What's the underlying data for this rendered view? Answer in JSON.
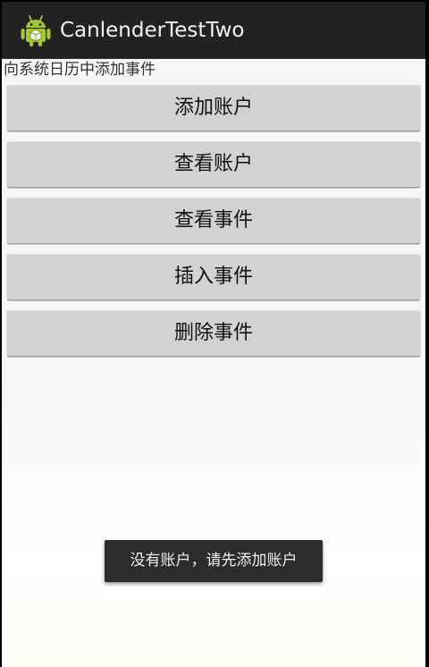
{
  "app": {
    "title": "CanlenderTestTwo",
    "icon": "android-robot-icon"
  },
  "main": {
    "subtitle": "向系统日历中添加事件",
    "buttons": [
      {
        "label": "添加账户"
      },
      {
        "label": "查看账户"
      },
      {
        "label": "查看事件"
      },
      {
        "label": "插入事件"
      },
      {
        "label": "删除事件"
      }
    ]
  },
  "toast": {
    "message": "没有账户，请先添加账户"
  },
  "colors": {
    "actionbar": "#222222",
    "button": "#d2d2d2",
    "android_green": "#a4c639"
  }
}
